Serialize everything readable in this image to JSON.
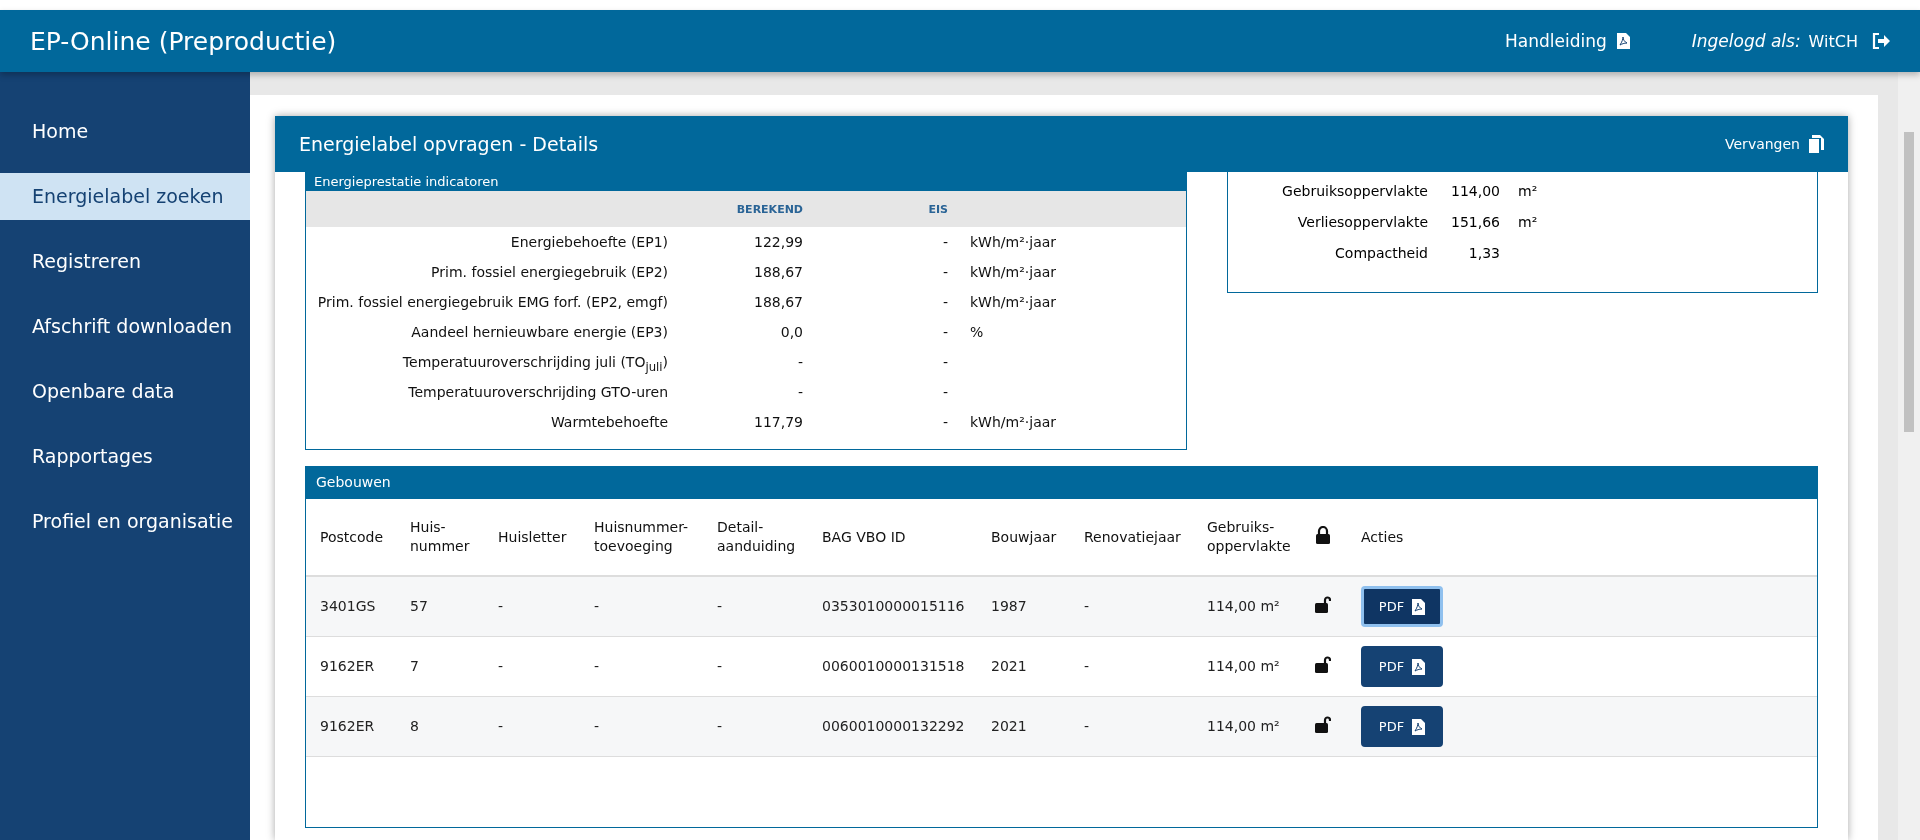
{
  "header": {
    "title": "EP-Online (Preproductie)",
    "manual": "Handleiding",
    "login_label": "Ingelogd als:",
    "user": "WitCH"
  },
  "sidebar": {
    "items": [
      {
        "label": "Home",
        "selected": false
      },
      {
        "label": "Energielabel zoeken",
        "selected": true
      },
      {
        "label": "Registreren",
        "selected": false
      },
      {
        "label": "Afschrift downloaden",
        "selected": false
      },
      {
        "label": "Openbare data",
        "selected": false
      },
      {
        "label": "Rapportages",
        "selected": false
      },
      {
        "label": "Profiel en organisatie",
        "selected": false
      }
    ]
  },
  "dialog": {
    "title": "Energielabel opvragen - Details",
    "action": "Vervangen",
    "indicators": {
      "title": "Energieprestatie indicatoren",
      "columns": [
        "BEREKEND",
        "EIS"
      ],
      "rows": [
        {
          "label": "Energiebehoefte (EP1)",
          "calculated": "122,99",
          "requirement": "-",
          "unit": "kWh/m²·jaar"
        },
        {
          "label": "Prim. fossiel energiegebruik (EP2)",
          "calculated": "188,67",
          "requirement": "-",
          "unit": "kWh/m²·jaar"
        },
        {
          "label": "Prim. fossiel energiegebruik EMG forf. (EP2, emgf)",
          "calculated": "188,67",
          "requirement": "-",
          "unit": "kWh/m²·jaar"
        },
        {
          "label": "Aandeel hernieuwbare energie (EP3)",
          "calculated": "0,0",
          "requirement": "-",
          "unit": "%"
        },
        {
          "label": "Temperatuuroverschrijding juli (TO$_{juli}$)",
          "calculated": "-",
          "requirement": "-"
        },
        {
          "label": "Temperatuuroverschrijding GTO-uren",
          "calculated": "-",
          "requirement": "-"
        },
        {
          "label": "Warmtebehoefte",
          "calculated": "117,79",
          "requirement": "-",
          "unit": "kWh/m²·jaar"
        }
      ]
    },
    "dimensions": {
      "rows": [
        {
          "label": "Gebruiksoppervlakte",
          "value": "114,00",
          "unit": "m²"
        },
        {
          "label": "Verliesoppervlakte",
          "value": "151,66",
          "unit": "m²"
        },
        {
          "label": "Compactheid",
          "value": "1,33"
        }
      ]
    },
    "buildings": {
      "title": "Gebouwen",
      "columns": [
        {
          "kind": "text",
          "label": "Postcode"
        },
        {
          "kind": "text",
          "label": "Huis-\nnummer"
        },
        {
          "kind": "text",
          "label": "Huisletter"
        },
        {
          "kind": "text",
          "label": "Huisnummer-\ntoevoeging"
        },
        {
          "kind": "text",
          "label": "Detail-\naanduiding"
        },
        {
          "kind": "text",
          "label": "BAG VBO ID"
        },
        {
          "kind": "text",
          "label": "Bouwjaar"
        },
        {
          "kind": "text",
          "label": "Renovatiejaar"
        },
        {
          "kind": "text",
          "label": "Gebruiks-\noppervlakte"
        },
        {
          "kind": "lock"
        },
        {
          "kind": "text",
          "label": "Acties"
        }
      ],
      "rows": [
        {
          "cells": [
            "3401GS",
            "57",
            "-",
            "-",
            "-",
            "0353010000015116",
            "1987",
            "-",
            "114,00 m²"
          ],
          "locked": false,
          "action": "PDF",
          "focused": true
        },
        {
          "cells": [
            "9162ER",
            "7",
            "-",
            "-",
            "-",
            "0060010000131518",
            "2021",
            "-",
            "114,00 m²"
          ],
          "locked": false,
          "action": "PDF",
          "focused": false
        },
        {
          "cells": [
            "9162ER",
            "8",
            "-",
            "-",
            "-",
            "0060010000132292",
            "2021",
            "-",
            "114,00 m²"
          ],
          "locked": false,
          "action": "PDF",
          "focused": false
        }
      ]
    }
  }
}
